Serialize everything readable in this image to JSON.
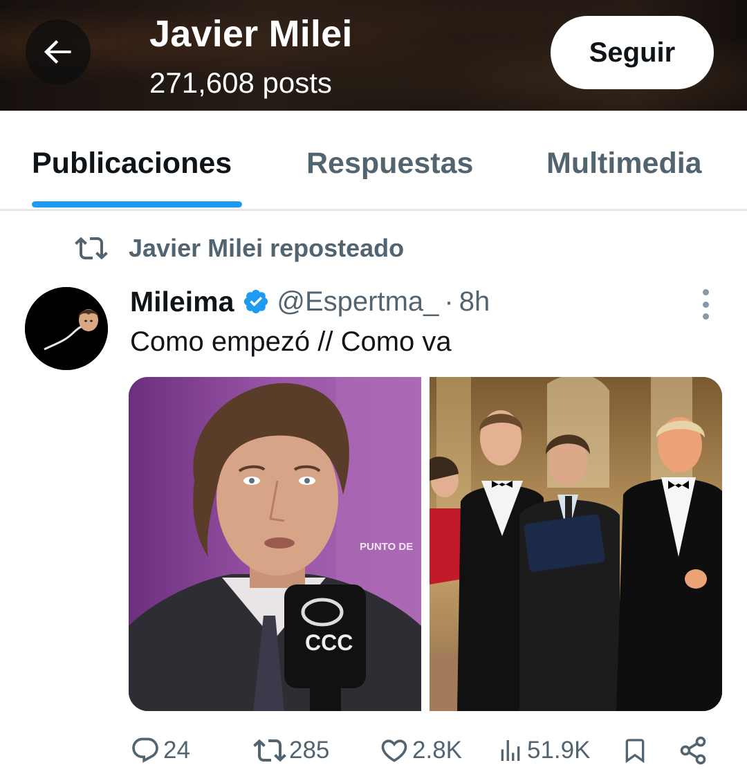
{
  "header": {
    "title": "Javier Milei",
    "posts_count": "271,608 posts",
    "follow_label": "Seguir",
    "back_icon": "arrow-left-icon"
  },
  "tabs": [
    {
      "label": "Publicaciones",
      "active": true
    },
    {
      "label": "Respuestas",
      "active": false
    },
    {
      "label": "Multimedia",
      "active": false
    }
  ],
  "repost_banner": {
    "icon": "repost-icon",
    "text": "Javier Milei reposteado"
  },
  "tweet": {
    "display_name": "Mileima",
    "verified": true,
    "handle": "@Espertma_",
    "separator": "·",
    "time": "8h",
    "text": "Como empezó // Como va",
    "media": {
      "left_overlay_text": "PUNTO DE",
      "left_mic_logo": "CCC"
    },
    "actions": {
      "replies": "24",
      "reposts": "285",
      "likes": "2.8K",
      "views": "51.9K"
    }
  },
  "colors": {
    "accent": "#1d9bf0",
    "muted_text": "#536471",
    "primary_text": "#0f1419"
  }
}
